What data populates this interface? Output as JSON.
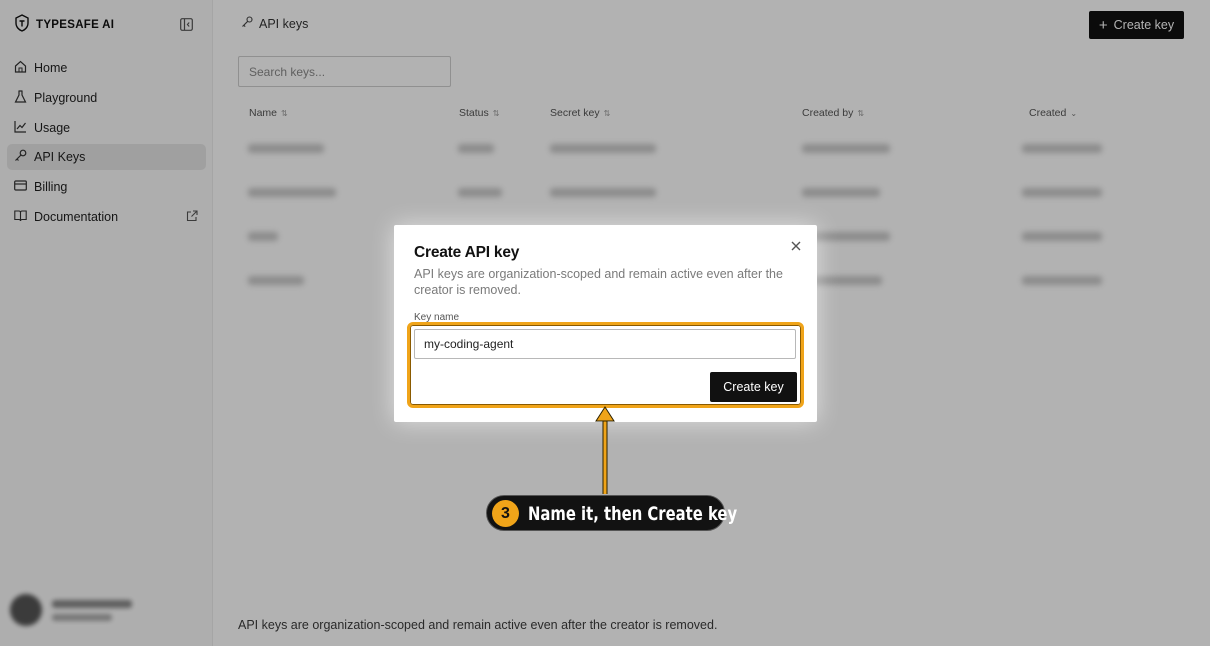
{
  "app": {
    "brand_name": "TYPESAFE AI"
  },
  "sidebar": {
    "items": [
      {
        "label": "Home",
        "icon": "home-icon"
      },
      {
        "label": "Playground",
        "icon": "flask-icon"
      },
      {
        "label": "Usage",
        "icon": "chart-icon"
      },
      {
        "label": "API Keys",
        "icon": "key-icon",
        "active": true
      },
      {
        "label": "Billing",
        "icon": "card-icon"
      },
      {
        "label": "Documentation",
        "icon": "book-icon",
        "external": true
      }
    ]
  },
  "header": {
    "breadcrumb": "API keys",
    "create_button": "Create key"
  },
  "search": {
    "placeholder": "Search keys..."
  },
  "table": {
    "columns": [
      "Name",
      "Status",
      "Secret key",
      "Created by",
      "Created"
    ]
  },
  "footer_note": "API keys are organization-scoped and remain active even after the creator is removed.",
  "modal": {
    "title": "Create API key",
    "description": "API keys are organization-scoped and remain active even after the creator is removed.",
    "field_label": "Key name",
    "field_value": "my-coding-agent",
    "create_button": "Create key"
  },
  "annotation": {
    "step_number": "3",
    "text": "Name it, then Create key",
    "color": "#f0a419"
  }
}
